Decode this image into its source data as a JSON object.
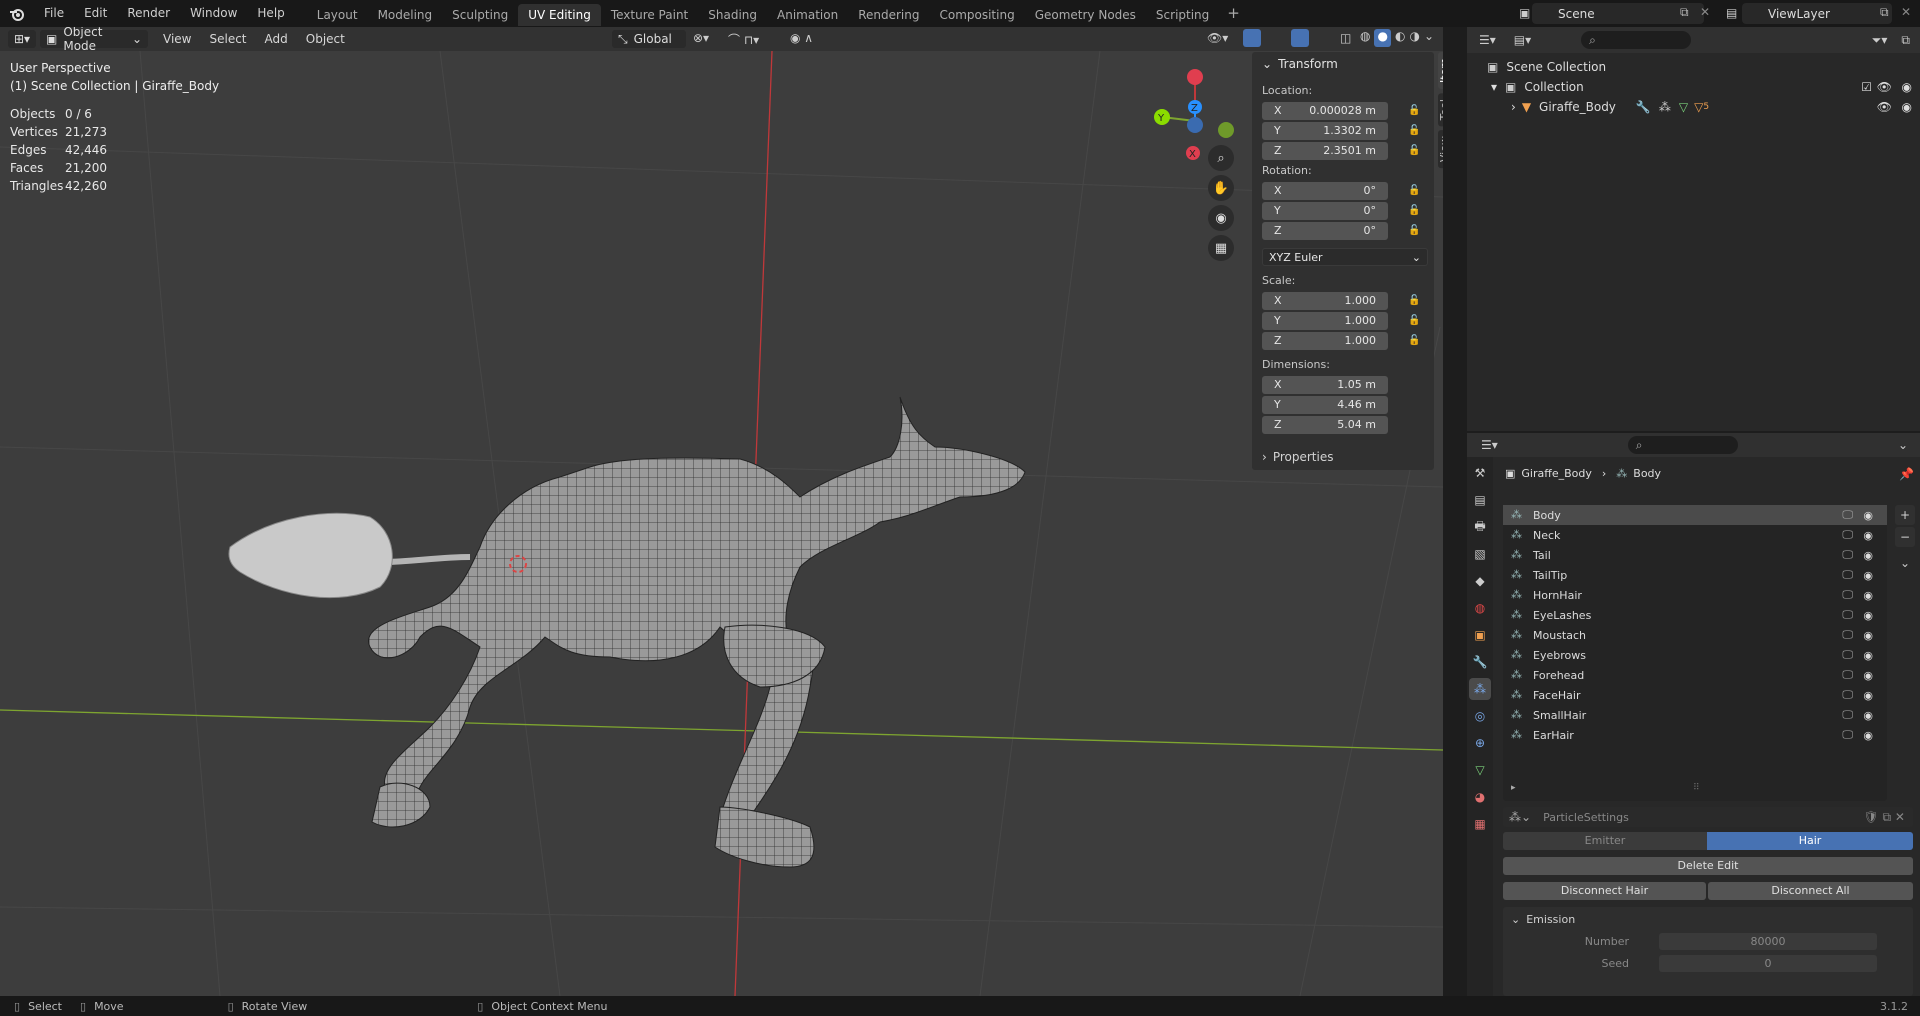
{
  "menu": [
    "File",
    "Edit",
    "Render",
    "Window",
    "Help"
  ],
  "workspaces": [
    "Layout",
    "Modeling",
    "Sculpting",
    "UV Editing",
    "Texture Paint",
    "Shading",
    "Animation",
    "Rendering",
    "Compositing",
    "Geometry Nodes",
    "Scripting"
  ],
  "active_workspace": "UV Editing",
  "scene": {
    "name": "Scene",
    "view_layer": "ViewLayer"
  },
  "viewport": {
    "mode": "Object Mode",
    "menus": [
      "View",
      "Select",
      "Add",
      "Object"
    ],
    "orientation": "Global",
    "perspective": "User Perspective",
    "collection_info": "(1) Scene Collection | Giraffe_Body",
    "stats": [
      {
        "k": "Objects",
        "v": "0 / 6"
      },
      {
        "k": "Vertices",
        "v": "21,273"
      },
      {
        "k": "Edges",
        "v": "42,446"
      },
      {
        "k": "Faces",
        "v": "21,200"
      },
      {
        "k": "Triangles",
        "v": "42,260"
      }
    ]
  },
  "npanel": {
    "title": "Transform",
    "location_label": "Location:",
    "location": [
      {
        "ax": "X",
        "v": "0.000028 m"
      },
      {
        "ax": "Y",
        "v": "1.3302 m"
      },
      {
        "ax": "Z",
        "v": "2.3501 m"
      }
    ],
    "rotation_label": "Rotation:",
    "rotation": [
      {
        "ax": "X",
        "v": "0°"
      },
      {
        "ax": "Y",
        "v": "0°"
      },
      {
        "ax": "Z",
        "v": "0°"
      }
    ],
    "rotation_mode": "XYZ Euler",
    "scale_label": "Scale:",
    "scale": [
      {
        "ax": "X",
        "v": "1.000"
      },
      {
        "ax": "Y",
        "v": "1.000"
      },
      {
        "ax": "Z",
        "v": "1.000"
      }
    ],
    "dimensions_label": "Dimensions:",
    "dimensions": [
      {
        "ax": "X",
        "v": "1.05 m"
      },
      {
        "ax": "Y",
        "v": "4.46 m"
      },
      {
        "ax": "Z",
        "v": "5.04 m"
      }
    ],
    "properties_label": "Properties",
    "tabs": [
      "Item",
      "Tool",
      "View"
    ]
  },
  "outliner": {
    "root": "Scene Collection",
    "collection": "Collection",
    "object": "Giraffe_Body",
    "modifier_count": "5"
  },
  "properties": {
    "breadcrumb_object": "Giraffe_Body",
    "breadcrumb_system": "Body",
    "particle_systems": [
      "Body",
      "Neck",
      "Tail",
      "TailTip",
      "HornHair",
      "EyeLashes",
      "Moustach",
      "Eyebrows",
      "Forehead",
      "FaceHair",
      "SmallHair",
      "EarHair"
    ],
    "settings_name": "ParticleSettings",
    "emitter_label": "Emitter",
    "hair_label": "Hair",
    "delete_edit": "Delete Edit",
    "disconnect_hair": "Disconnect Hair",
    "disconnect_all": "Disconnect All",
    "emission_label": "Emission",
    "number_label": "Number",
    "number_value": "80000",
    "seed_label": "Seed",
    "seed_value": "0"
  },
  "statusbar": {
    "select": "Select",
    "move": "Move",
    "rotate": "Rotate View",
    "context": "Object Context Menu",
    "version": "3.1.2"
  },
  "colors": {
    "accent": "#4772b3",
    "x_axis": "#ff3352",
    "y_axis": "#8bdc00",
    "z_axis": "#2890ff"
  }
}
